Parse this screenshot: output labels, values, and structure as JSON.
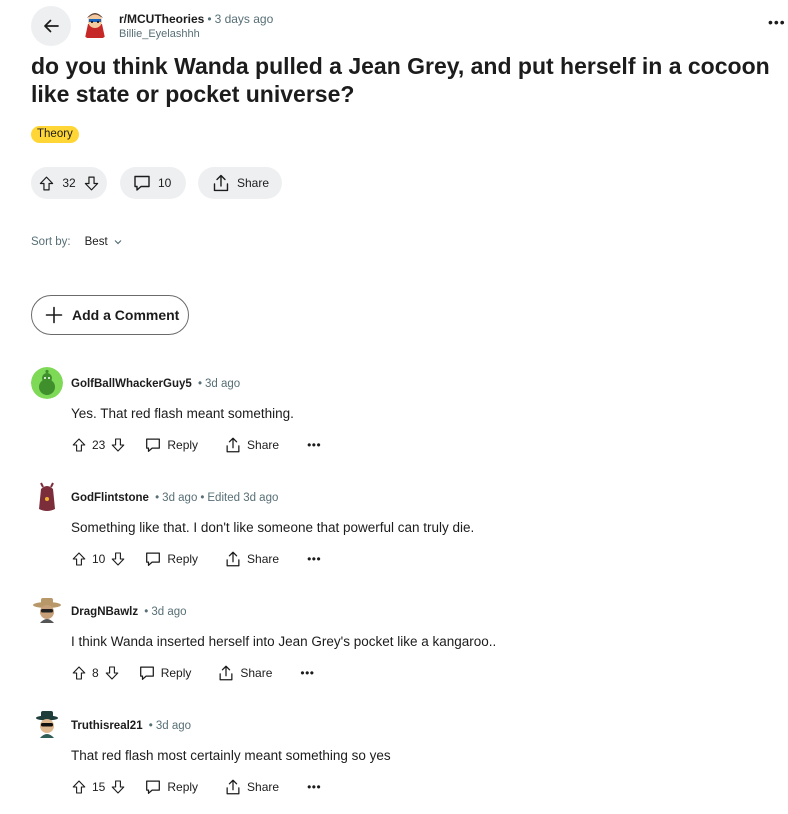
{
  "post": {
    "subreddit": "r/MCUTheories",
    "time": "3 days ago",
    "author": "Billie_Eyelashhh",
    "title": "do you think Wanda pulled a Jean Grey, and put herself in a cocoon like state or pocket universe?",
    "flair": "Theory",
    "flair_color": "#ffd635",
    "votes": "32",
    "comments": "10",
    "share_label": "Share",
    "more": "•••"
  },
  "sort": {
    "label": "Sort by:",
    "value": "Best"
  },
  "add_comment": "Add a Comment",
  "comments": [
    {
      "user": "GolfBallWhackerGuy5",
      "time": "3d ago",
      "edited": "",
      "body": "Yes. That red flash meant something.",
      "votes": "23",
      "reply": "Reply",
      "share": "Share",
      "more": "•••"
    },
    {
      "user": "GodFlintstone",
      "time": "3d ago",
      "edited": "Edited 3d ago",
      "body": "Something like that. I don't like someone that powerful can truly die.",
      "votes": "10",
      "reply": "Reply",
      "share": "Share",
      "more": "•••"
    },
    {
      "user": "DragNBawlz",
      "time": "3d ago",
      "edited": "",
      "body": "I think Wanda inserted herself into Jean Grey's pocket like a kangaroo..",
      "votes": "8",
      "reply": "Reply",
      "share": "Share",
      "more": "•••"
    },
    {
      "user": "Truthisreal21",
      "time": "3d ago",
      "edited": "",
      "body": "That red flash most certainly meant something so yes",
      "votes": "15",
      "reply": "Reply",
      "share": "Share",
      "more": "•••"
    }
  ],
  "colors": {
    "meta": "#576f76",
    "pill": "#edeff1",
    "text": "#1c1c1c"
  }
}
